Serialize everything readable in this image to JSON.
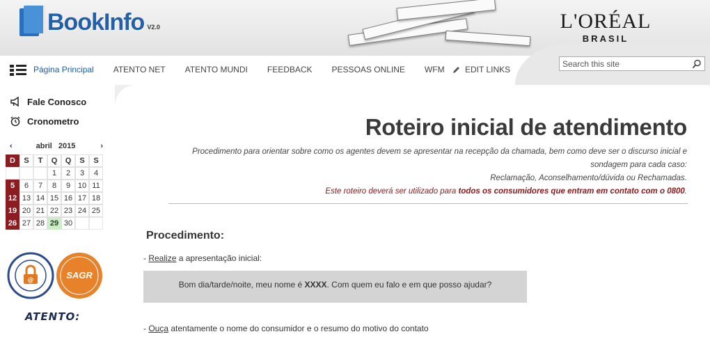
{
  "header": {
    "logo_text": "BookInfo",
    "logo_version": "V2.0",
    "brand_name": "L'ORÉAL",
    "brand_sub": "BRASIL"
  },
  "nav": {
    "items": [
      {
        "label": "Página Principal",
        "active": true
      },
      {
        "label": "ATENTO NET"
      },
      {
        "label": "ATENTO MUNDI"
      },
      {
        "label": "FEEDBACK"
      },
      {
        "label": "PESSOAS ONLINE"
      },
      {
        "label": "WFM"
      }
    ],
    "edit_links": "EDIT LINKS",
    "search_placeholder": "Search this site"
  },
  "sidebar": {
    "links": [
      {
        "label": "Fale Conosco",
        "icon": "megaphone-icon"
      },
      {
        "label": "Cronometro",
        "icon": "alarm-clock-icon"
      }
    ],
    "calendar": {
      "month": "abril",
      "year": "2015",
      "prev": "‹",
      "next": "›",
      "weekdays": [
        "D",
        "S",
        "T",
        "Q",
        "Q",
        "S",
        "S"
      ],
      "weeks": [
        [
          "",
          "",
          "",
          "1",
          "2",
          "3",
          "4"
        ],
        [
          "5",
          "6",
          "7",
          "8",
          "9",
          "10",
          "11"
        ],
        [
          "12",
          "13",
          "14",
          "15",
          "16",
          "17",
          "18"
        ],
        [
          "19",
          "20",
          "21",
          "22",
          "23",
          "24",
          "25"
        ],
        [
          "26",
          "27",
          "28",
          "29",
          "30",
          "",
          ""
        ]
      ],
      "today": "29"
    },
    "badges": {
      "security": "POLÍTICA DE SEGURANÇA DA INFORMAÇÃO",
      "sagr": "SAGR"
    },
    "atento": "ATENTO:"
  },
  "main": {
    "title": "Roteiro inicial de atendimento",
    "intro_line1": "Procedimento para orientar sobre como os agentes devem se apresentar na recepção da chamada, bem como deve ser o discurso inicial e",
    "intro_line2": "sondagem para cada caso:",
    "intro_line3": "Reclamação, Aconselhamento/dúvida ou Rechamadas.",
    "intro_line4_prefix": "Este roteiro deverá ser utilizado para ",
    "intro_line4_bold": "todos os consumidores que entram em contato com o 0800",
    "intro_line4_suffix": ".",
    "procedure_title": "Procedimento:",
    "step1_prefix": "- ",
    "step1_link": "Realize",
    "step1_rest": " a apresentação inicial:",
    "script_prefix": "Bom dia/tarde/noite, meu nome é ",
    "script_bold": "XXXX",
    "script_suffix": ". Com quem eu falo e em que posso ajudar?",
    "step2_prefix": "- ",
    "step2_link": "Ouça",
    "step2_rest": " atentamente o nome do consumidor e o resumo do motivo do contato"
  },
  "colors": {
    "accent_blue": "#1a5ea8",
    "sunday_red": "#8c1c20",
    "today_green": "#c8f0c0",
    "intro_red": "#8a1a1a"
  }
}
